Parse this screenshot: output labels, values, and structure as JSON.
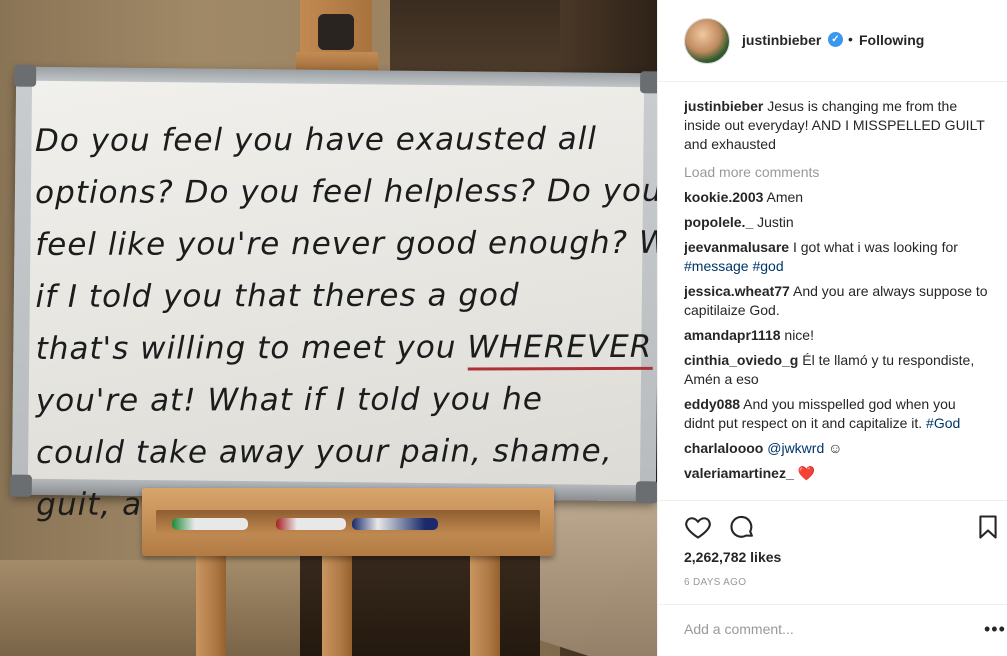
{
  "post": {
    "board_lines": [
      "Do you feel you have exausted all",
      "options? Do you feel helpless? Do you",
      "feel like you're never good enough? What",
      "if I told you that theres a god",
      "that's willing to meet you WHEREVER",
      "you're at! What if I told you he",
      "could take away your pain, shame,",
      "guit, and fears #JESUS"
    ]
  },
  "header": {
    "username": "justinbieber",
    "verified_glyph": "✓",
    "dot": "•",
    "follow_status": "Following"
  },
  "caption": {
    "username": "justinbieber",
    "text": "Jesus is changing me from the inside out everyday! AND I MISSPELLED GUILT and exhausted"
  },
  "load_more": "Load more comments",
  "comments": [
    {
      "user": "kookie.2003",
      "text": "Amen"
    },
    {
      "user": "popolele._",
      "text": "Justin"
    },
    {
      "user": "jeevanmalusare",
      "text": "I got what i was looking for",
      "tags": "#message #god"
    },
    {
      "user": "jessica.wheat77",
      "text": "And you are always suppose to capitilaize God."
    },
    {
      "user": "amandapr1118",
      "text": "nice!"
    },
    {
      "user": "cinthia_oviedo_g",
      "text": "Él te llamó y tu respondiste, Amén a eso"
    },
    {
      "user": "eddy088",
      "text": "And you misspelled god when you didnt put respect on it and capitalize it.",
      "tags": "#God"
    },
    {
      "user": "charlaloooo",
      "text": "",
      "tags": "@jwkwrd",
      "emoji": "☺"
    },
    {
      "user": "valeriamartinez_",
      "text": "❤️"
    }
  ],
  "actions": {
    "likes": "2,262,782 likes",
    "date": "6 DAYS AGO"
  },
  "add_comment": {
    "placeholder": "Add a comment...",
    "more": "•••"
  },
  "colors": {
    "link": "#003569",
    "verified": "#3897f0",
    "muted": "#999999"
  }
}
